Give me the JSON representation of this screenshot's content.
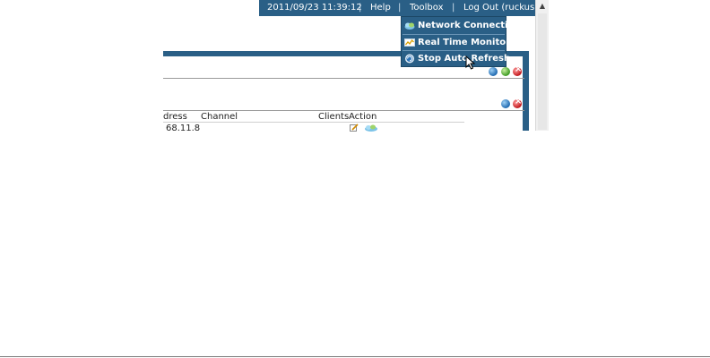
{
  "header": {
    "datetime": "2011/09/23  11:39:12",
    "separator": "|",
    "help": "Help",
    "toolbox": "Toolbox",
    "logout": "Log Out (ruckus)"
  },
  "toolbox_menu": {
    "items": [
      {
        "label": "Network Connectivity",
        "icon": "network-cloud-icon"
      },
      {
        "label": "Real Time Monitoring",
        "icon": "chart-monitor-icon"
      },
      {
        "label": "Stop Auto Refresh",
        "icon": "stop-refresh-icon"
      }
    ],
    "hovered_index": 2
  },
  "table": {
    "columns": [
      "dress",
      "Channel",
      "Clients",
      "Action"
    ],
    "rows": [
      {
        "address": "68.11.8",
        "channel": "",
        "clients": ""
      }
    ]
  },
  "colors": {
    "header_bg": "#2a5f86",
    "panel_border": "#2a5f86"
  }
}
